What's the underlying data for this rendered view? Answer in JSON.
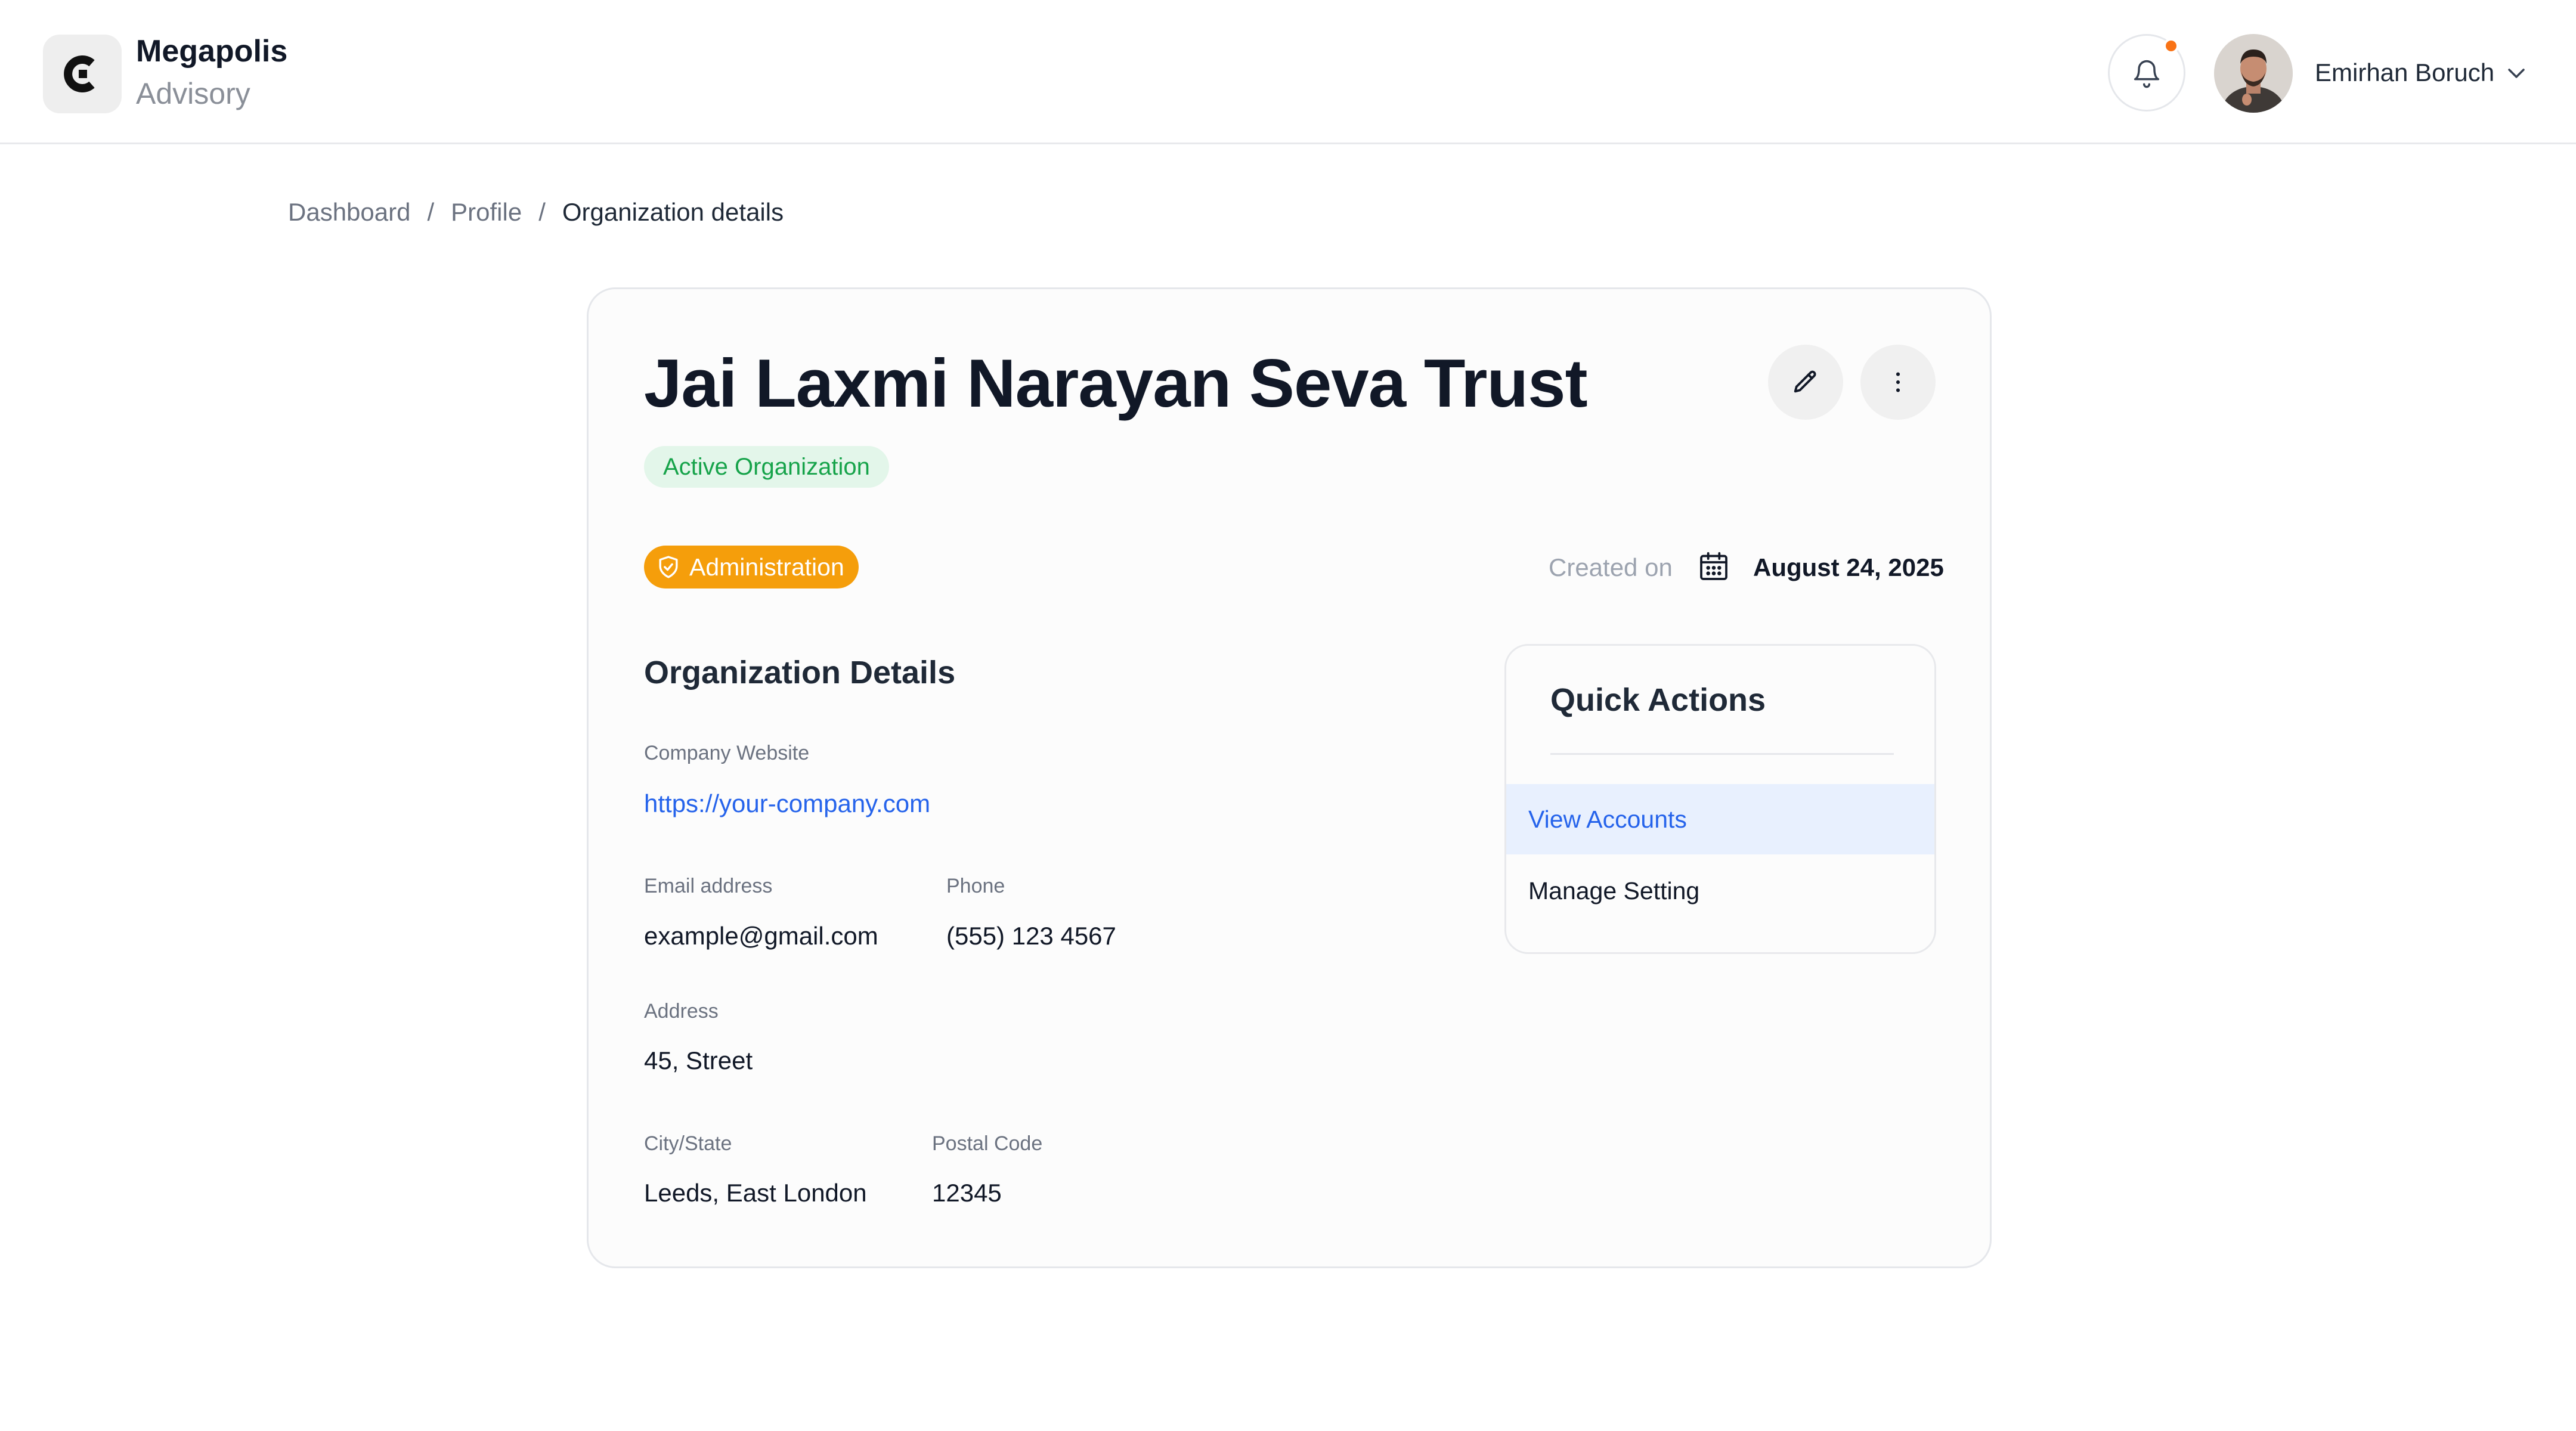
{
  "brand": {
    "name": "Megapolis",
    "subtitle": "Advisory",
    "logo_icon": "c-logo-icon"
  },
  "header": {
    "notification_icon": "bell-icon",
    "notification_dot_color": "#f97316",
    "user_name": "Emirhan Boruch",
    "user_menu_icon": "chevron-down-icon"
  },
  "breadcrumb": {
    "items": [
      "Dashboard",
      "Profile",
      "Organization details"
    ],
    "separator": "/"
  },
  "organization": {
    "name": "Jai Laxmi Narayan Seva Trust",
    "status": "Active Organization",
    "role": "Administration",
    "role_icon": "shield-check-icon",
    "created_label": "Created on",
    "created_date": "August 24, 2025",
    "edit_icon": "pencil-icon",
    "more_icon": "more-vertical-icon"
  },
  "details": {
    "section_title": "Organization Details",
    "website_label": "Company Website",
    "website_value": "https://your-company.com",
    "email_label": "Email address",
    "email_value": "example@gmail.com",
    "phone_label": "Phone",
    "phone_value": "(555) 123 4567",
    "address_label": "Address",
    "address_value": "45, Street",
    "city_label": "City/State",
    "city_value": "Leeds, East London",
    "postal_label": "Postal Code",
    "postal_value": "12345"
  },
  "quick_actions": {
    "title": "Quick Actions",
    "items": [
      "View Accounts",
      "Manage Setting"
    ]
  },
  "colors": {
    "accent": "#2563eb",
    "status_green": "#16a34a",
    "role_orange": "#f59e0b"
  }
}
